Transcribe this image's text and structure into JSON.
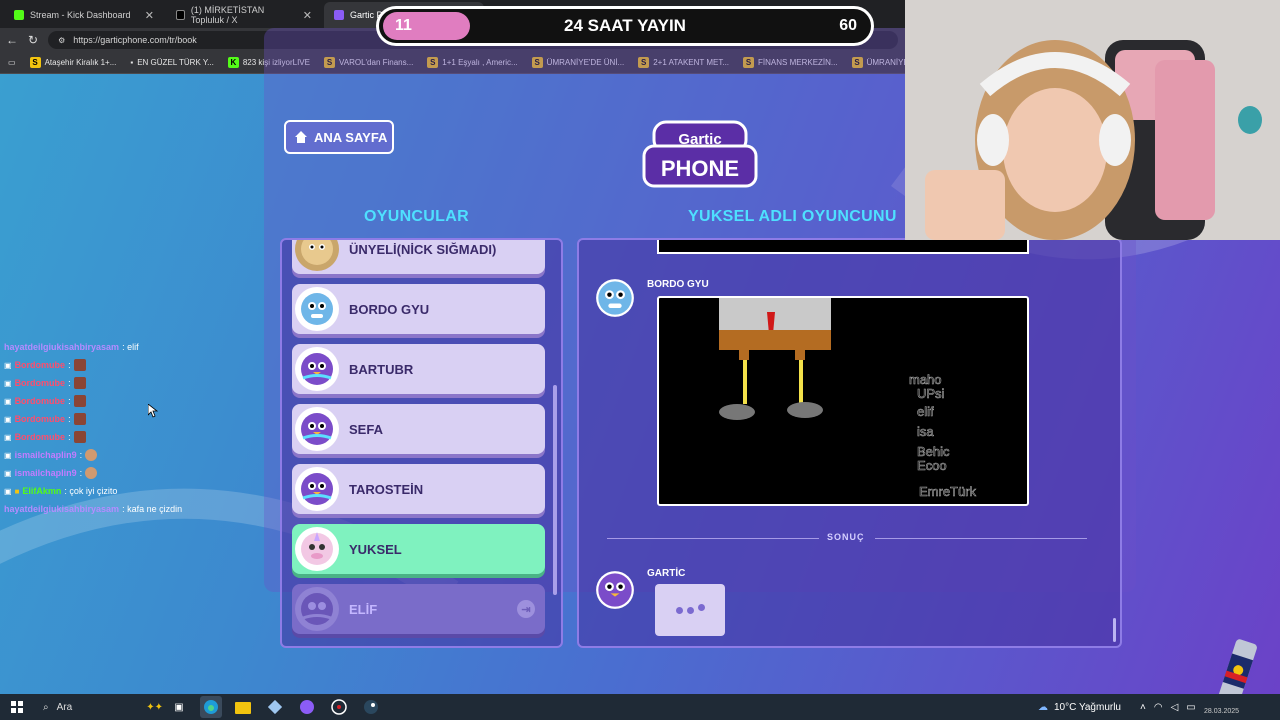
{
  "browser": {
    "tabs": [
      {
        "label": "Stream - Kick Dashboard",
        "active": false
      },
      {
        "label": "(1) MİRKETİSTAN Topluluk / X",
        "active": false
      },
      {
        "label": "Gartic Pho",
        "active": true
      }
    ],
    "url": "https://garticphone.com/tr/book",
    "bookmarks": [
      "Ataşehir Kiralık 1+...",
      "EN GÜZEL TÜRK Y...",
      "823 kişi izliyorLIVE",
      "VAROL'dan Finans...",
      "1+1 Eşyalı , Americ...",
      "ÜMRANİYE'DE ÜNİ...",
      "2+1 ATAKENT MET...",
      "FİNANS MERKEZİN...",
      "ÜMRANİYE"
    ]
  },
  "overlay": {
    "left": "11",
    "title": "24 SAAT YAYIN",
    "right": "60",
    "progress_fraction": 0.18
  },
  "game": {
    "home_label": "ANA SAYFA",
    "logo_top": "Gartic",
    "logo_bottom": "PHONE",
    "players_title": "OYUNCULAR",
    "album_title": "YUKSEL ADLI OYUNCUNU",
    "players": [
      {
        "name": "ÜNYELİ(NİCK SIĞMADI)",
        "state": "normal",
        "avatar_color": "#c9a66b"
      },
      {
        "name": "BORDO GYU",
        "state": "normal",
        "avatar_color": "#6fb6e8"
      },
      {
        "name": "BARTUBR",
        "state": "normal",
        "avatar_color": "#7b4cc9"
      },
      {
        "name": "SEFA",
        "state": "normal",
        "avatar_color": "#7b4cc9"
      },
      {
        "name": "TAROSTEİN",
        "state": "normal",
        "avatar_color": "#7b4cc9"
      },
      {
        "name": "YUKSEL",
        "state": "active",
        "avatar_color": "#f2c8e4"
      },
      {
        "name": "ELİF",
        "state": "offline",
        "avatar_color": "#6a56b8"
      }
    ],
    "album": {
      "drawer": "BORDO GYU",
      "drawing_text": [
        "maho",
        "UPsi",
        "elif",
        "isa",
        "Behic",
        "Ecoo",
        "EmreTürk"
      ],
      "result_label": "SONUÇ",
      "next_drawer": "GARTİC"
    }
  },
  "chat": [
    {
      "user": "hayatdeilgiukisahbiryasam",
      "text": ": elif",
      "badge": false,
      "color": "#b48cff",
      "emote": null
    },
    {
      "user": "Bordomube",
      "text": ":",
      "badge": true,
      "color": "#ff4d6d",
      "emote": "brick"
    },
    {
      "user": "Bordomube",
      "text": ":",
      "badge": true,
      "color": "#ff4d6d",
      "emote": "brick"
    },
    {
      "user": "Bordomube",
      "text": ":",
      "badge": true,
      "color": "#ff4d6d",
      "emote": "brick"
    },
    {
      "user": "Bordomube",
      "text": ":",
      "badge": true,
      "color": "#ff4d6d",
      "emote": "brick"
    },
    {
      "user": "Bordomube",
      "text": ":",
      "badge": true,
      "color": "#ff4d6d",
      "emote": "brick"
    },
    {
      "user": "ismailchaplin9",
      "text": ":",
      "badge": true,
      "color": "#c27cff",
      "emote": "cat"
    },
    {
      "user": "ismailchaplin9",
      "text": ":",
      "badge": true,
      "color": "#c27cff",
      "emote": "cat"
    },
    {
      "user": "ElifAkmn",
      "text": ": çok iyi çizito",
      "badge": true,
      "color": "#53fc18",
      "emote": null
    },
    {
      "user": "hayatdeilgiukisahbiryasam",
      "text": ": kafa ne çizdin",
      "badge": false,
      "color": "#b48cff",
      "emote": null
    }
  ],
  "taskbar": {
    "search_label": "Ara",
    "weather": "10°C  Yağmurlu",
    "date": "28.03.2025"
  }
}
